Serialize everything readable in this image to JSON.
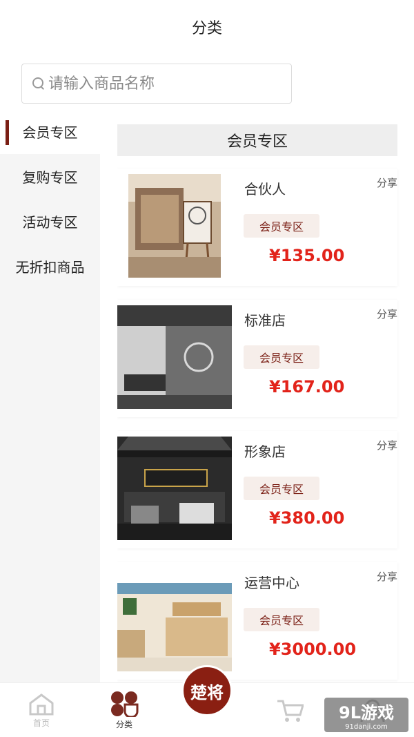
{
  "header": {
    "title": "分类"
  },
  "search": {
    "placeholder": "请输入商品名称"
  },
  "sidebar": {
    "items": [
      {
        "label": "会员专区",
        "active": true
      },
      {
        "label": "复购专区",
        "active": false
      },
      {
        "label": "活动专区",
        "active": false
      },
      {
        "label": "无折扣商品",
        "active": false
      }
    ]
  },
  "section": {
    "title": "会员专区"
  },
  "products": [
    {
      "name": "合伙人",
      "share": "分享",
      "tag": "会员专区",
      "price": "¥135.00"
    },
    {
      "name": "标准店",
      "share": "分享",
      "tag": "会员专区",
      "price": "¥167.00"
    },
    {
      "name": "形象店",
      "share": "分享",
      "tag": "会员专区",
      "price": "¥380.00"
    },
    {
      "name": "运营中心",
      "share": "分享",
      "tag": "会员专区",
      "price": "¥3000.00"
    }
  ],
  "tabbar": {
    "home_label": "首页",
    "category_label": "分类",
    "logo_text": "楚将"
  },
  "watermark": {
    "title": "9L游戏",
    "url": "91danji.com"
  },
  "colors": {
    "accent": "#7a1e14",
    "price": "#e2231a",
    "tag_bg": "#f6eeea"
  }
}
